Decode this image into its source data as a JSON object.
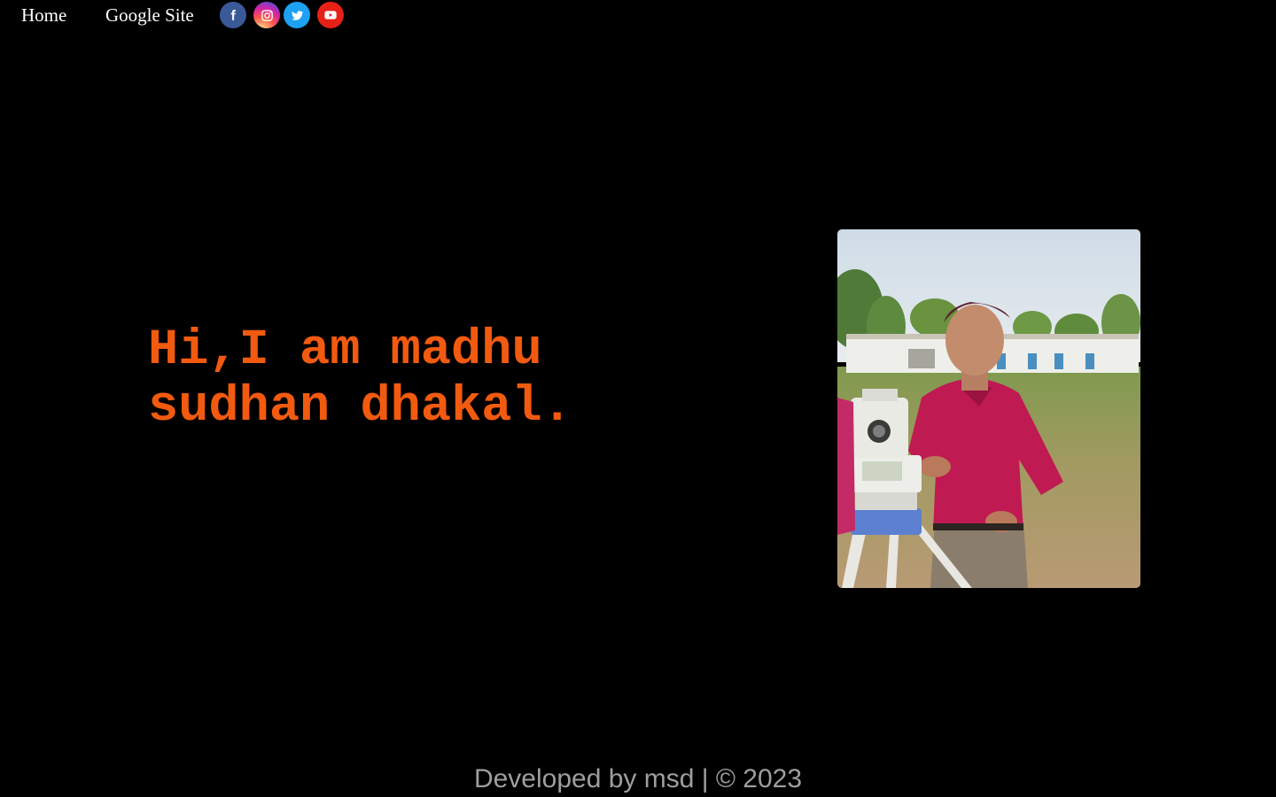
{
  "nav": {
    "home_label": "Home",
    "google_site_label": "Google Site",
    "social": [
      {
        "icon": "facebook-icon",
        "color": "#3b5998"
      },
      {
        "icon": "instagram-icon",
        "color": "#d6249f"
      },
      {
        "icon": "twitter-icon",
        "color": "#1da1f2"
      },
      {
        "icon": "youtube-icon",
        "color": "#e62117"
      }
    ]
  },
  "hero": {
    "headline": "Hi,I am madhu sudhan dhakal.",
    "headline_color": "#f15a0f",
    "photo_icon": "profile-photo"
  },
  "footer": {
    "text": "Developed by msd | © 2023",
    "color": "#9e9e9e"
  },
  "colors": {
    "background": "#000000",
    "nav_text": "#ffffff"
  }
}
